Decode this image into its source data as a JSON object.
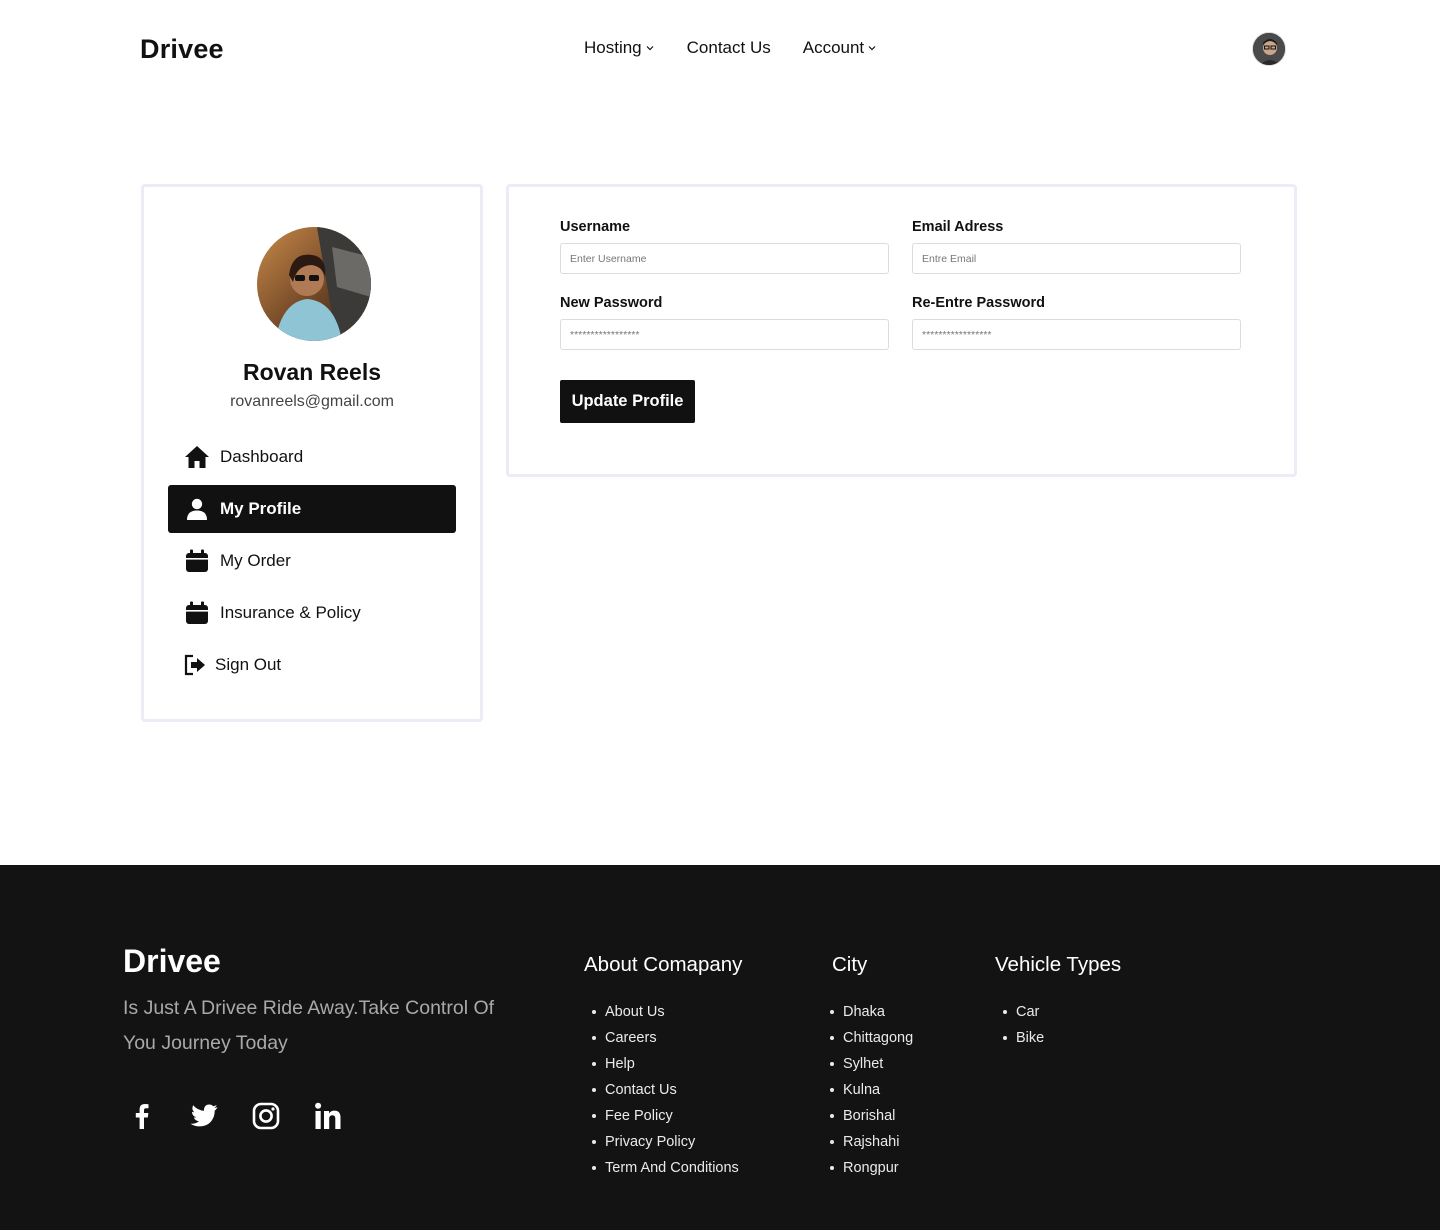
{
  "header": {
    "brand": "Drivee",
    "nav": [
      {
        "label": "Hosting",
        "dropdown": true
      },
      {
        "label": "Contact Us",
        "dropdown": false
      },
      {
        "label": "Account",
        "dropdown": true
      }
    ],
    "avatar_icon": "user-avatar"
  },
  "sidebar": {
    "name": "Rovan Reels",
    "email": "rovanreels@gmail.com",
    "items": [
      {
        "label": "Dashboard",
        "icon": "home-icon"
      },
      {
        "label": "My Profile",
        "icon": "user-icon",
        "active": true
      },
      {
        "label": "My Order",
        "icon": "calendar-icon"
      },
      {
        "label": "Insurance & Policy",
        "icon": "calendar-icon"
      },
      {
        "label": "Sign Out",
        "icon": "sign-out-icon"
      }
    ]
  },
  "form": {
    "username_label": "Username",
    "username_placeholder": "Enter Username",
    "email_label": "Email Adress",
    "email_placeholder": "Entre Email",
    "password_label": "New Password",
    "password_placeholder": "*****************",
    "repassword_label": "Re-Entre Password",
    "repassword_placeholder": "*****************",
    "submit_label": "Update Profile"
  },
  "footer": {
    "brand": "Drivee",
    "tagline": "Is Just A Drivee Ride Away.Take Control Of You Journey Today",
    "socials": [
      "facebook-icon",
      "twitter-icon",
      "instagram-icon",
      "linkedin-icon"
    ],
    "columns": [
      {
        "title": "About Comapany",
        "links": [
          "About Us",
          "Careers",
          "Help",
          "Contact Us",
          "Fee Policy",
          "Privacy Policy",
          "Term And Conditions"
        ]
      },
      {
        "title": "City",
        "links": [
          "Dhaka",
          "Chittagong",
          "Sylhet",
          "Kulna",
          "Borishal",
          "Rajshahi",
          "Rongpur"
        ]
      },
      {
        "title": "Vehicle Types",
        "links": [
          "Car",
          "Bike"
        ]
      }
    ]
  },
  "colors": {
    "primary": "#111111",
    "card_border": "#ecebf7",
    "footer_bg": "#141313",
    "footer_muted": "#a9a9a9"
  }
}
